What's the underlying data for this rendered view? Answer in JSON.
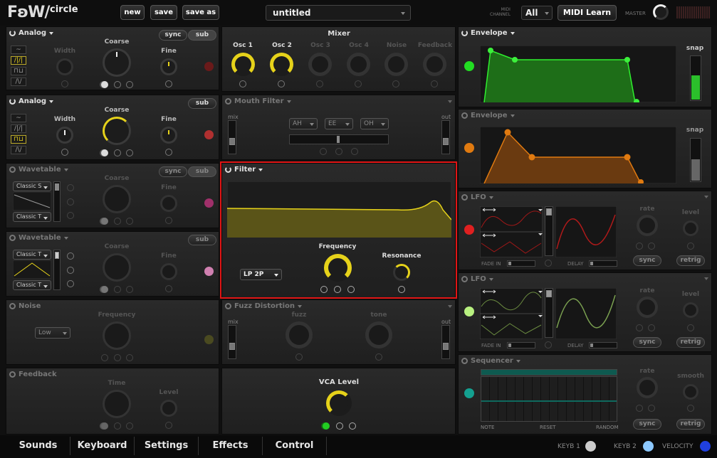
{
  "app": {
    "logo": "FʚW/",
    "name": "circle",
    "preset": "untitled",
    "midi_channel_label": "MIDI\nCHANNEL",
    "midi_channel": "All",
    "midi_learn": "MIDI Learn",
    "master_label": "MASTER"
  },
  "toolbar": {
    "new": "new",
    "save": "save",
    "save_as": "save as"
  },
  "osc1": {
    "title": "Analog",
    "sync": "sync",
    "sub": "sub",
    "width": "Width",
    "coarse": "Coarse",
    "fine": "Fine"
  },
  "osc2": {
    "title": "Analog",
    "sub": "sub",
    "width": "Width",
    "coarse": "Coarse",
    "fine": "Fine"
  },
  "osc3": {
    "title": "Wavetable",
    "sync": "sync",
    "sub": "sub",
    "coarse": "Coarse",
    "fine": "Fine",
    "sel_a": "Classic S",
    "sel_b": "Classic T"
  },
  "osc4": {
    "title": "Wavetable",
    "sub": "sub",
    "coarse": "Coarse",
    "fine": "Fine",
    "sel_a": "Classic T",
    "sel_b": "Classic T"
  },
  "noise": {
    "title": "Noise",
    "mode": "Low",
    "frequency": "Frequency"
  },
  "feedback": {
    "title": "Feedback",
    "time": "Time",
    "level": "Level"
  },
  "mixer": {
    "title": "Mixer",
    "channels": [
      "Osc 1",
      "Osc 2",
      "Osc 3",
      "Osc 4",
      "Noise",
      "Feedback"
    ]
  },
  "mouth": {
    "title": "Mouth Filter",
    "mix": "mix",
    "out": "out",
    "vowels": [
      "AH",
      "EE",
      "OH"
    ]
  },
  "filter": {
    "title": "Filter",
    "type": "LP 2P",
    "frequency": "Frequency",
    "resonance": "Resonance"
  },
  "fuzz": {
    "title": "Fuzz Distortion",
    "mix": "mix",
    "out": "out",
    "fuzz": "fuzz",
    "tone": "tone"
  },
  "vca": {
    "title": "VCA Level"
  },
  "env1": {
    "title": "Envelope",
    "snap": "snap",
    "color": "#22dd22"
  },
  "env2": {
    "title": "Envelope",
    "snap": "snap",
    "color": "#e07a10"
  },
  "lfo1": {
    "title": "LFO",
    "fade_in": "FADE IN",
    "delay": "DELAY",
    "rate": "rate",
    "level": "level",
    "sync": "sync",
    "retrig": "retrig",
    "color": "#e02020"
  },
  "lfo2": {
    "title": "LFO",
    "fade_in": "FADE IN",
    "delay": "DELAY",
    "rate": "rate",
    "level": "level",
    "sync": "sync",
    "retrig": "retrig",
    "color": "#b8f080"
  },
  "seq": {
    "title": "Sequencer",
    "rate": "rate",
    "smooth": "smooth",
    "note": "NOTE",
    "reset": "RESET",
    "random": "RANDOM",
    "sync": "sync",
    "retrig": "retrig",
    "color": "#14a090"
  },
  "tabs": [
    "Sounds",
    "Keyboard",
    "Settings",
    "Effects",
    "Control"
  ],
  "footer": {
    "keyb1": "KEYB 1",
    "keyb2": "KEYB 2",
    "velocity": "VELOCITY"
  }
}
